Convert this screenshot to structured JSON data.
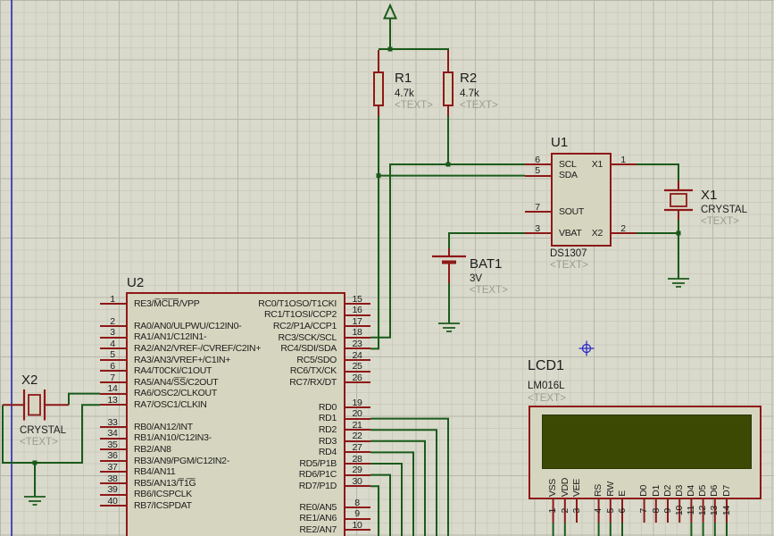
{
  "colors": {
    "sheet_bg": "#d9dacb",
    "wire_green": "#1a5a1b",
    "component_red": "#8e1818",
    "component_fill": "#d6d6c0",
    "lcd_screen": "#3c4903",
    "ghost_text": "#9b9c8e",
    "sheet_border_blue": "#1c1cb8"
  },
  "r1": {
    "ref": "R1",
    "value": "4.7k",
    "text": "<TEXT>"
  },
  "r2": {
    "ref": "R2",
    "value": "4.7k",
    "text": "<TEXT>"
  },
  "u1": {
    "ref": "U1",
    "part": "DS1307",
    "text": "<TEXT>",
    "pins_i2c": [
      {
        "n": "6",
        "l": "SCL"
      },
      {
        "n": "5",
        "l": "SDA"
      }
    ],
    "pin_sout": [
      {
        "n": "7",
        "l": "SOUT"
      }
    ],
    "pin_vbat": [
      {
        "n": "3",
        "l": "VBAT"
      }
    ],
    "pin_x1": [
      {
        "n": "1",
        "l": "X1"
      }
    ],
    "pin_x2": [
      {
        "n": "2",
        "l": "X2"
      }
    ]
  },
  "x1": {
    "ref": "X1",
    "part": "CRYSTAL",
    "text": "<TEXT>"
  },
  "x2": {
    "ref": "X2",
    "part": "CRYSTAL",
    "text": "<TEXT>"
  },
  "bat1": {
    "ref": "BAT1",
    "value": "3V",
    "text": "<TEXT>"
  },
  "u2": {
    "ref": "U2",
    "left_a": [
      {
        "n": "1",
        "l": "RE3/M̅C̅L̅R̅/VPP"
      }
    ],
    "left_b": [
      {
        "n": "2",
        "l": "RA0/AN0/ULPWU/C12IN0-"
      },
      {
        "n": "3",
        "l": "RA1/AN1/C12IN1-"
      },
      {
        "n": "4",
        "l": "RA2/AN2/VREF-/CVREF/C2IN+"
      },
      {
        "n": "5",
        "l": "RA3/AN3/VREF+/C1IN+"
      },
      {
        "n": "6",
        "l": "RA4/T0CKI/C1OUT"
      },
      {
        "n": "7",
        "l": "RA5/AN4/S̅S̅/C2OUT"
      },
      {
        "n": "14",
        "l": "RA6/OSC2/CLKOUT"
      },
      {
        "n": "13",
        "l": "RA7/OSC1/CLKIN"
      }
    ],
    "left_c": [
      {
        "n": "33",
        "l": "RB0/AN12/INT"
      },
      {
        "n": "34",
        "l": "RB1/AN10/C12IN3-"
      },
      {
        "n": "35",
        "l": "RB2/AN8"
      },
      {
        "n": "36",
        "l": "RB3/AN9/PGM/C12IN2-"
      },
      {
        "n": "37",
        "l": "RB4/AN11"
      },
      {
        "n": "38",
        "l": "RB5/AN13/T̅1̅G̅"
      },
      {
        "n": "39",
        "l": "RB6/ICSPCLK"
      },
      {
        "n": "40",
        "l": "RB7/ICSPDAT"
      }
    ],
    "right_a": [
      {
        "n": "15",
        "l": "RC0/T1OSO/T1CKI"
      },
      {
        "n": "16",
        "l": "RC1/T1OSI/CCP2"
      },
      {
        "n": "17",
        "l": "RC2/P1A/CCP1"
      },
      {
        "n": "18",
        "l": "RC3/SCK/SCL"
      },
      {
        "n": "23",
        "l": "RC4/SDI/SDA"
      },
      {
        "n": "24",
        "l": "RC5/SDO"
      },
      {
        "n": "25",
        "l": "RC6/TX/CK"
      },
      {
        "n": "26",
        "l": "RC7/RX/DT"
      }
    ],
    "right_b": [
      {
        "n": "19",
        "l": "RD0"
      },
      {
        "n": "20",
        "l": "RD1"
      },
      {
        "n": "21",
        "l": "RD2"
      },
      {
        "n": "22",
        "l": "RD3"
      },
      {
        "n": "27",
        "l": "RD4"
      },
      {
        "n": "28",
        "l": "RD5/P1B"
      },
      {
        "n": "29",
        "l": "RD6/P1C"
      },
      {
        "n": "30",
        "l": "RD7/P1D"
      }
    ],
    "right_c": [
      {
        "n": "8",
        "l": "RE0/AN5"
      },
      {
        "n": "9",
        "l": "RE1/AN6"
      },
      {
        "n": "10",
        "l": "RE2/AN7"
      }
    ]
  },
  "lcd1": {
    "ref": "LCD1",
    "part": "LM016L",
    "text": "<TEXT>",
    "groups": [
      {
        "pins": [
          {
            "n": "1",
            "l": "VSS"
          },
          {
            "n": "2",
            "l": "VDD"
          },
          {
            "n": "3",
            "l": "VEE"
          }
        ]
      },
      {
        "pins": [
          {
            "n": "4",
            "l": "RS"
          },
          {
            "n": "5",
            "l": "RW"
          },
          {
            "n": "6",
            "l": "E"
          }
        ]
      },
      {
        "pins": [
          {
            "n": "7",
            "l": "D0"
          },
          {
            "n": "8",
            "l": "D1"
          },
          {
            "n": "9",
            "l": "D2"
          },
          {
            "n": "10",
            "l": "D3"
          },
          {
            "n": "11",
            "l": "D4"
          },
          {
            "n": "12",
            "l": "D5"
          },
          {
            "n": "13",
            "l": "D6"
          },
          {
            "n": "14",
            "l": "D7"
          }
        ]
      }
    ]
  }
}
